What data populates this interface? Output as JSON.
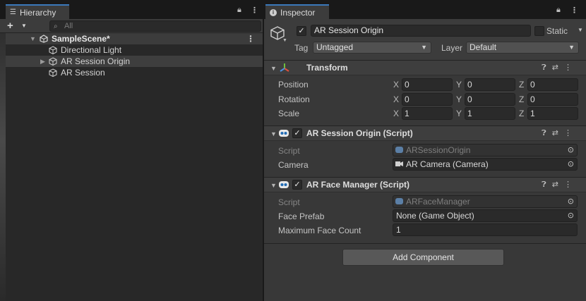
{
  "hierarchy": {
    "tab_label": "Hierarchy",
    "search_placeholder": "All",
    "scene_name": "SampleScene*",
    "items": [
      {
        "label": "Directional Light"
      },
      {
        "label": "AR Session Origin"
      },
      {
        "label": "AR Session"
      }
    ]
  },
  "inspector": {
    "tab_label": "Inspector",
    "object_name": "AR Session Origin",
    "static_label": "Static",
    "tag_label": "Tag",
    "tag_value": "Untagged",
    "layer_label": "Layer",
    "layer_value": "Default",
    "transform": {
      "title": "Transform",
      "rows": [
        {
          "label": "Position",
          "x": "0",
          "y": "0",
          "z": "0"
        },
        {
          "label": "Rotation",
          "x": "0",
          "y": "0",
          "z": "0"
        },
        {
          "label": "Scale",
          "x": "1",
          "y": "1",
          "z": "1"
        }
      ],
      "axis_x": "X",
      "axis_y": "Y",
      "axis_z": "Z"
    },
    "session_origin": {
      "title": "AR Session Origin (Script)",
      "script_label": "Script",
      "script_value": "ARSessionOrigin",
      "camera_label": "Camera",
      "camera_value": "AR Camera (Camera)"
    },
    "face_manager": {
      "title": "AR Face Manager (Script)",
      "script_label": "Script",
      "script_value": "ARFaceManager",
      "prefab_label": "Face Prefab",
      "prefab_value": "None (Game Object)",
      "count_label": "Maximum Face Count",
      "count_value": "1"
    },
    "add_component": "Add Component"
  },
  "colors": {
    "accent": "#3a79bb",
    "panel": "#383838",
    "hierarchy_bg": "#282828"
  }
}
